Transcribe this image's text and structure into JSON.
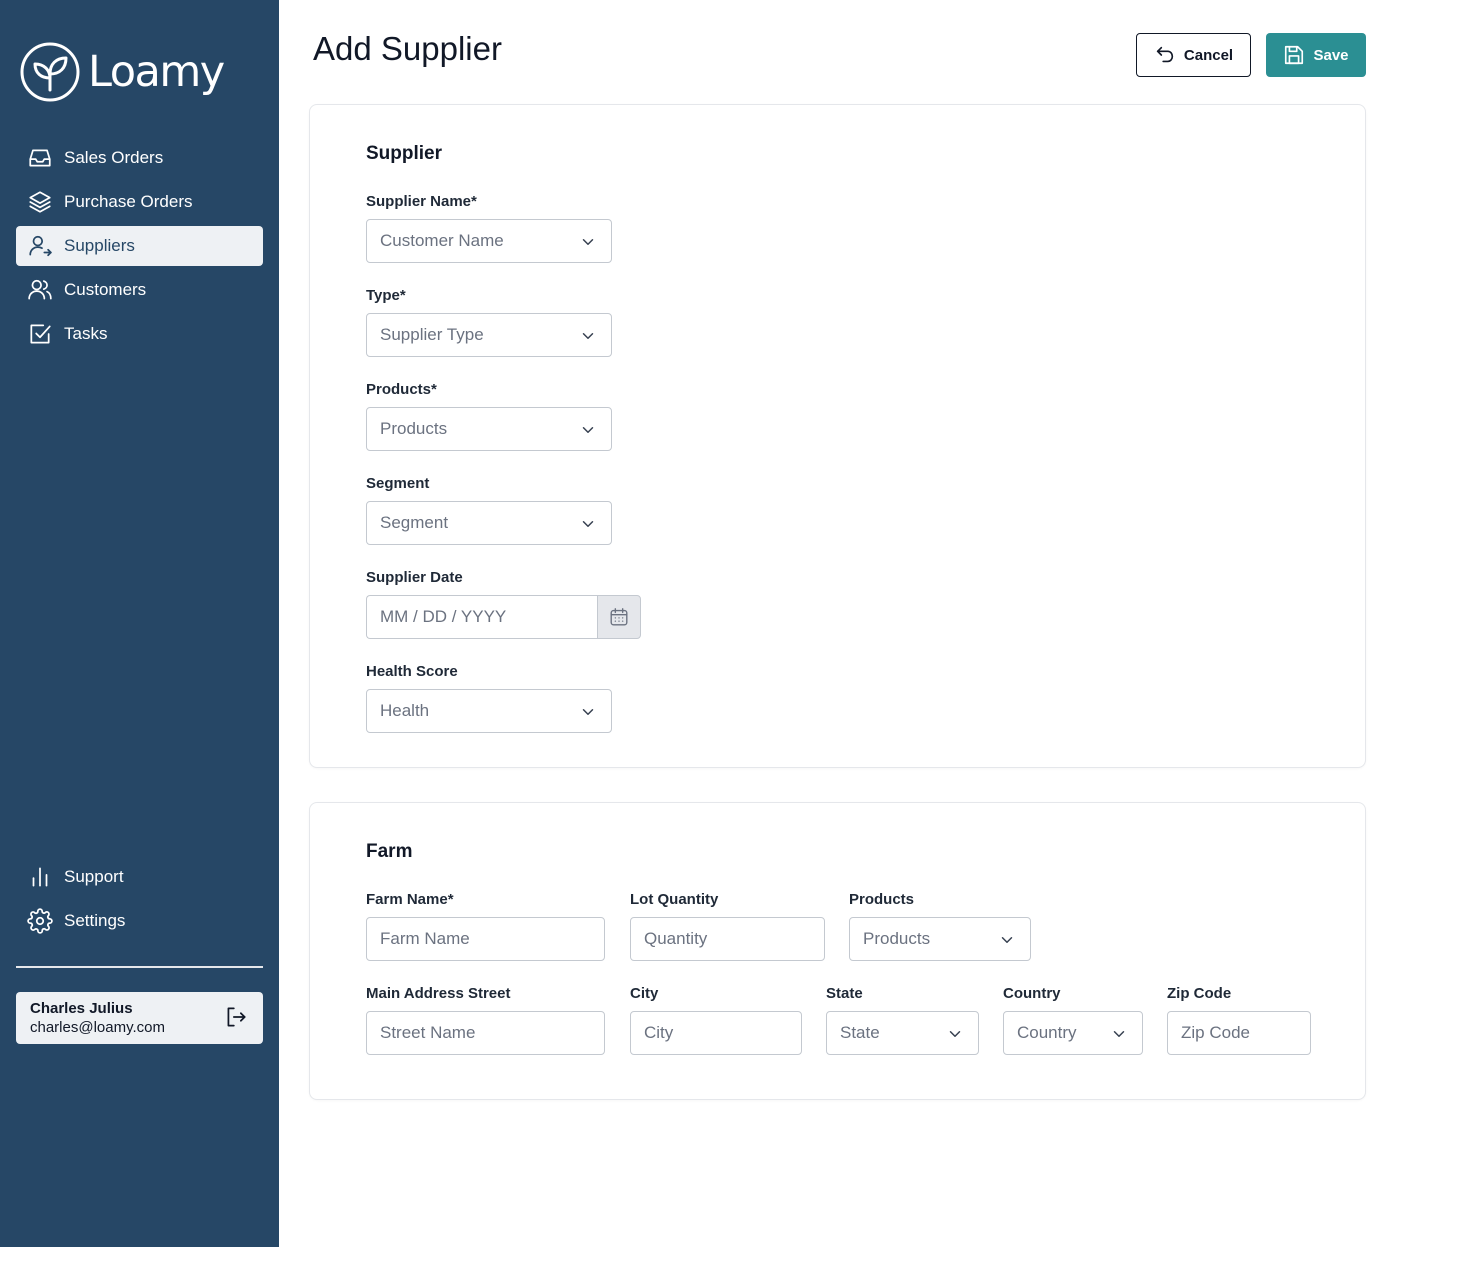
{
  "brand": {
    "name": "Loamy"
  },
  "nav": {
    "top": [
      {
        "label": "Sales Orders",
        "icon": "inbox-icon"
      },
      {
        "label": "Purchase Orders",
        "icon": "layers-icon"
      },
      {
        "label": "Suppliers",
        "icon": "user-arrow-icon",
        "active": true
      },
      {
        "label": "Customers",
        "icon": "users-icon"
      },
      {
        "label": "Tasks",
        "icon": "checkbox-icon"
      }
    ],
    "bottom": [
      {
        "label": "Support",
        "icon": "bar-chart-icon"
      },
      {
        "label": "Settings",
        "icon": "gear-icon"
      }
    ]
  },
  "user": {
    "name": "Charles Julius",
    "email": "charles@loamy.com"
  },
  "header": {
    "title": "Add Supplier",
    "cancel_label": "Cancel",
    "save_label": "Save"
  },
  "supplier": {
    "title": "Supplier",
    "name_label": "Supplier Name*",
    "name_placeholder": "Customer Name",
    "type_label": "Type*",
    "type_placeholder": "Supplier Type",
    "products_label": "Products*",
    "products_placeholder": "Products",
    "segment_label": "Segment",
    "segment_placeholder": "Segment",
    "date_label": "Supplier Date",
    "date_placeholder": "MM / DD / YYYY",
    "health_label": "Health Score",
    "health_placeholder": "Health"
  },
  "farm": {
    "title": "Farm",
    "farm_name_label": "Farm Name*",
    "farm_name_placeholder": "Farm Name",
    "lot_label": "Lot Quantity",
    "lot_placeholder": "Quantity",
    "products_label": "Products",
    "products_placeholder": "Products",
    "street_label": "Main Address Street",
    "street_placeholder": "Street Name",
    "city_label": "City",
    "city_placeholder": "City",
    "state_label": "State",
    "state_placeholder": "State",
    "country_label": "Country",
    "country_placeholder": "Country",
    "zip_label": "Zip Code",
    "zip_placeholder": "Zip Code"
  },
  "colors": {
    "sidebar": "#264766",
    "accent": "#2b8f93",
    "active_bg": "#eef1f4"
  }
}
